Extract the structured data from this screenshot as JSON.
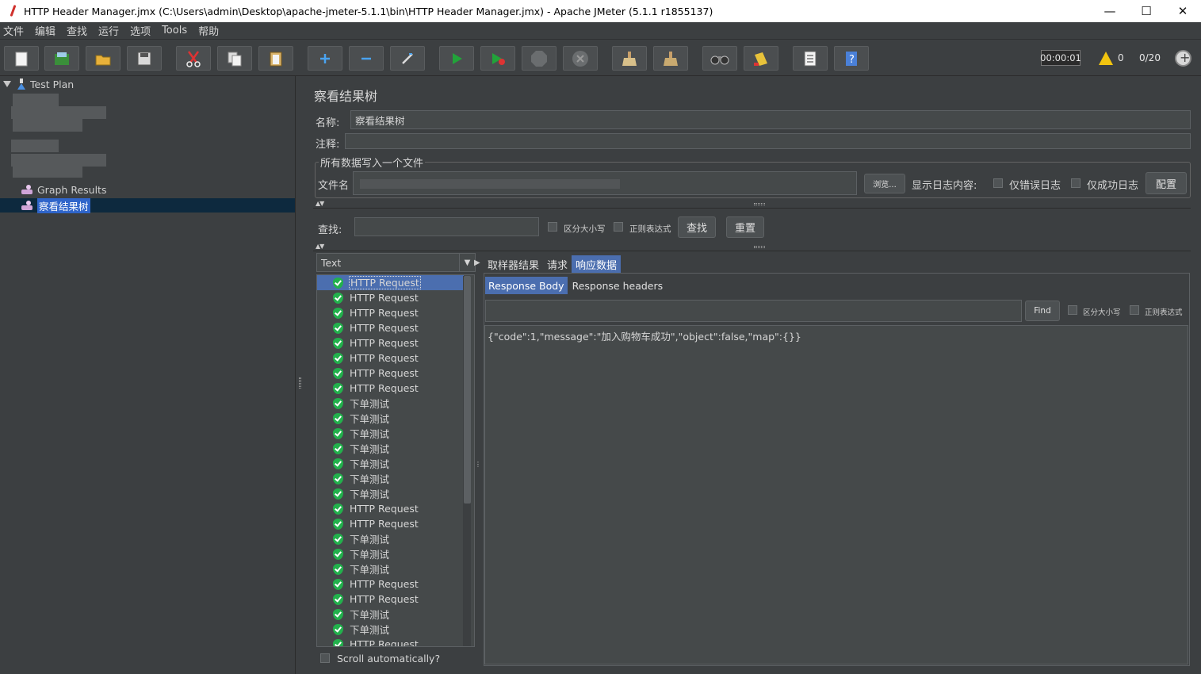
{
  "window": {
    "title": "HTTP Header Manager.jmx (C:\\Users\\admin\\Desktop\\apache-jmeter-5.1.1\\bin\\HTTP Header Manager.jmx) - Apache JMeter (5.1.1 r1855137)",
    "min": "—",
    "max": "☐",
    "close": "✕"
  },
  "menu": [
    "文件",
    "编辑",
    "查找",
    "运行",
    "选项",
    "Tools",
    "帮助"
  ],
  "toolbar": {
    "timer": "00:00:01",
    "warning_count": "0",
    "threads": "0/20"
  },
  "tree": {
    "root": "Test Plan",
    "graph_results": "Graph Results",
    "view_results_tree": "察看结果树"
  },
  "panel": {
    "title": "察看结果树",
    "name_label": "名称:",
    "name_value": "察看结果树",
    "comment_label": "注释:",
    "file_group_title": "所有数据写入一个文件",
    "filename_label": "文件名",
    "browse_button": "浏览...",
    "log_content_label": "显示日志内容:",
    "errors_only": "仅错误日志",
    "success_only": "仅成功日志",
    "configure_button": "配置",
    "search_label": "查找:",
    "case_sensitive": "区分大小写",
    "regex": "正则表达式",
    "search_button": "查找",
    "reset_button": "重置"
  },
  "results": {
    "renderer": "Text",
    "items": [
      "HTTP Request",
      "HTTP Request",
      "HTTP Request",
      "HTTP Request",
      "HTTP Request",
      "HTTP Request",
      "HTTP Request",
      "HTTP Request",
      "下单测试",
      "下单测试",
      "下单测试",
      "下单测试",
      "下单测试",
      "下单测试",
      "下单测试",
      "HTTP Request",
      "HTTP Request",
      "下单测试",
      "下单测试",
      "下单测试",
      "HTTP Request",
      "HTTP Request",
      "下单测试",
      "下单测试",
      "HTTP Request"
    ],
    "selected_index": 0,
    "scroll_auto": "Scroll automatically?"
  },
  "tabs": {
    "sampler_result": "取样器结果",
    "request": "请求",
    "response_data": "响应数据",
    "active": "response_data"
  },
  "response": {
    "body_tab": "Response Body",
    "headers_tab": "Response headers",
    "find_button": "Find",
    "case_sensitive": "区分大小写",
    "regex": "正则表达式",
    "body": "{\"code\":1,\"message\":\"加入购物车成功\",\"object\":false,\"map\":{}}"
  }
}
